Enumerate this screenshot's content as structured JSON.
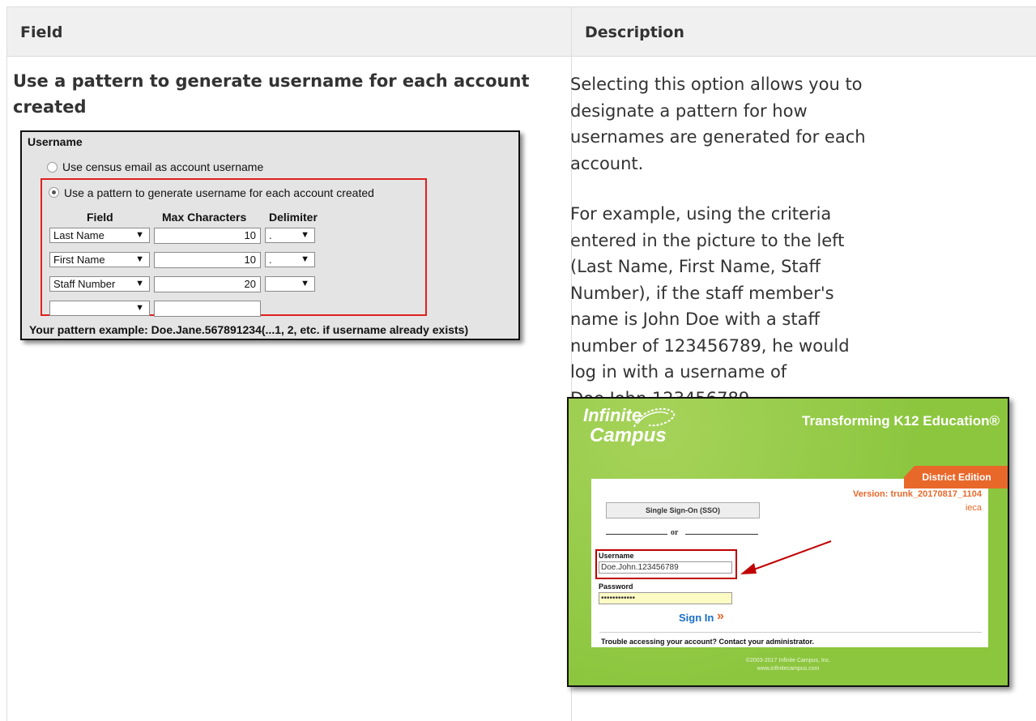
{
  "table": {
    "header_field": "Field",
    "header_description": "Description"
  },
  "field_title": "Use a pattern to generate username for each account created",
  "description": {
    "p1": "Selecting this option allows you to designate a pattern for how usernames are generated for each account.",
    "p2": "For example, using the criteria entered in the picture to the left (Last Name, First Name, Staff Number), if the staff member's name is John Doe with a staff number of 123456789, he would log in with a username of Doe.John.123456789"
  },
  "username_panel": {
    "title": "Username",
    "option_census": "Use census email as account username",
    "option_pattern": "Use a pattern to generate username for each account created",
    "col_field": "Field",
    "col_max": "Max Characters",
    "col_delim": "Delimiter",
    "rows": [
      {
        "field": "Last Name",
        "max": "10",
        "delim": "."
      },
      {
        "field": "First Name",
        "max": "10",
        "delim": "."
      },
      {
        "field": "Staff Number",
        "max": "20",
        "delim": ""
      },
      {
        "field": "",
        "max": "",
        "delim": null
      }
    ],
    "example": "Your pattern example: Doe.Jane.567891234(...1, 2, etc. if username already exists)",
    "arrow_glyph": "▼"
  },
  "login": {
    "logo_line1": "Infinite",
    "logo_line2": "Campus",
    "tagline": "Transforming K12 Education®",
    "edition": "District Edition",
    "version": "Version: trunk_20170817_1104",
    "site": "ieca",
    "sso_button": "Single Sign-On (SSO)",
    "or": "or",
    "username_label": "Username",
    "username_value": "Doe.John.123456789",
    "password_label": "Password",
    "password_value": "••••••••••••",
    "sign_in": "Sign In",
    "chevron": "»",
    "trouble": "Trouble accessing your account? Contact your administrator.",
    "copyright": "©2003-2017 Infinite Campus, Inc.",
    "website": "www.infinitecampus.com",
    "arrow_color": "#c00000",
    "brand_green": "#8cc63f",
    "brand_orange": "#e8682a"
  }
}
